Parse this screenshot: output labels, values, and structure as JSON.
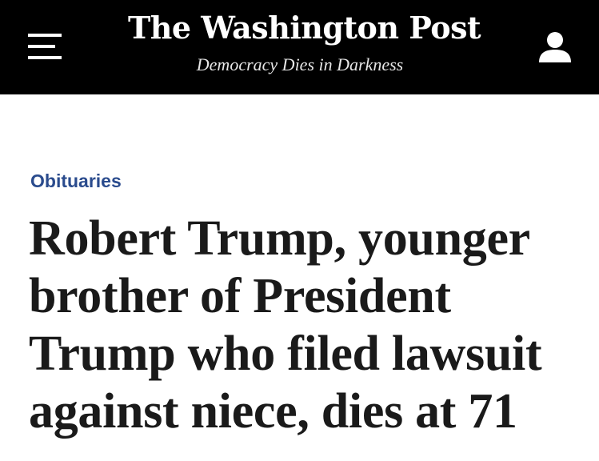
{
  "masthead": {
    "logo": "The Washington Post",
    "tagline": "Democracy Dies in Darkness",
    "menu_icon": "hamburger-menu-icon",
    "account_icon": "user-account-icon",
    "background": "#000000"
  },
  "article": {
    "section": "Obituaries",
    "section_color": "#2a4b8d",
    "headline": "Robert Trump, younger brother of President Trump who filed lawsuit against niece, dies at 71"
  }
}
